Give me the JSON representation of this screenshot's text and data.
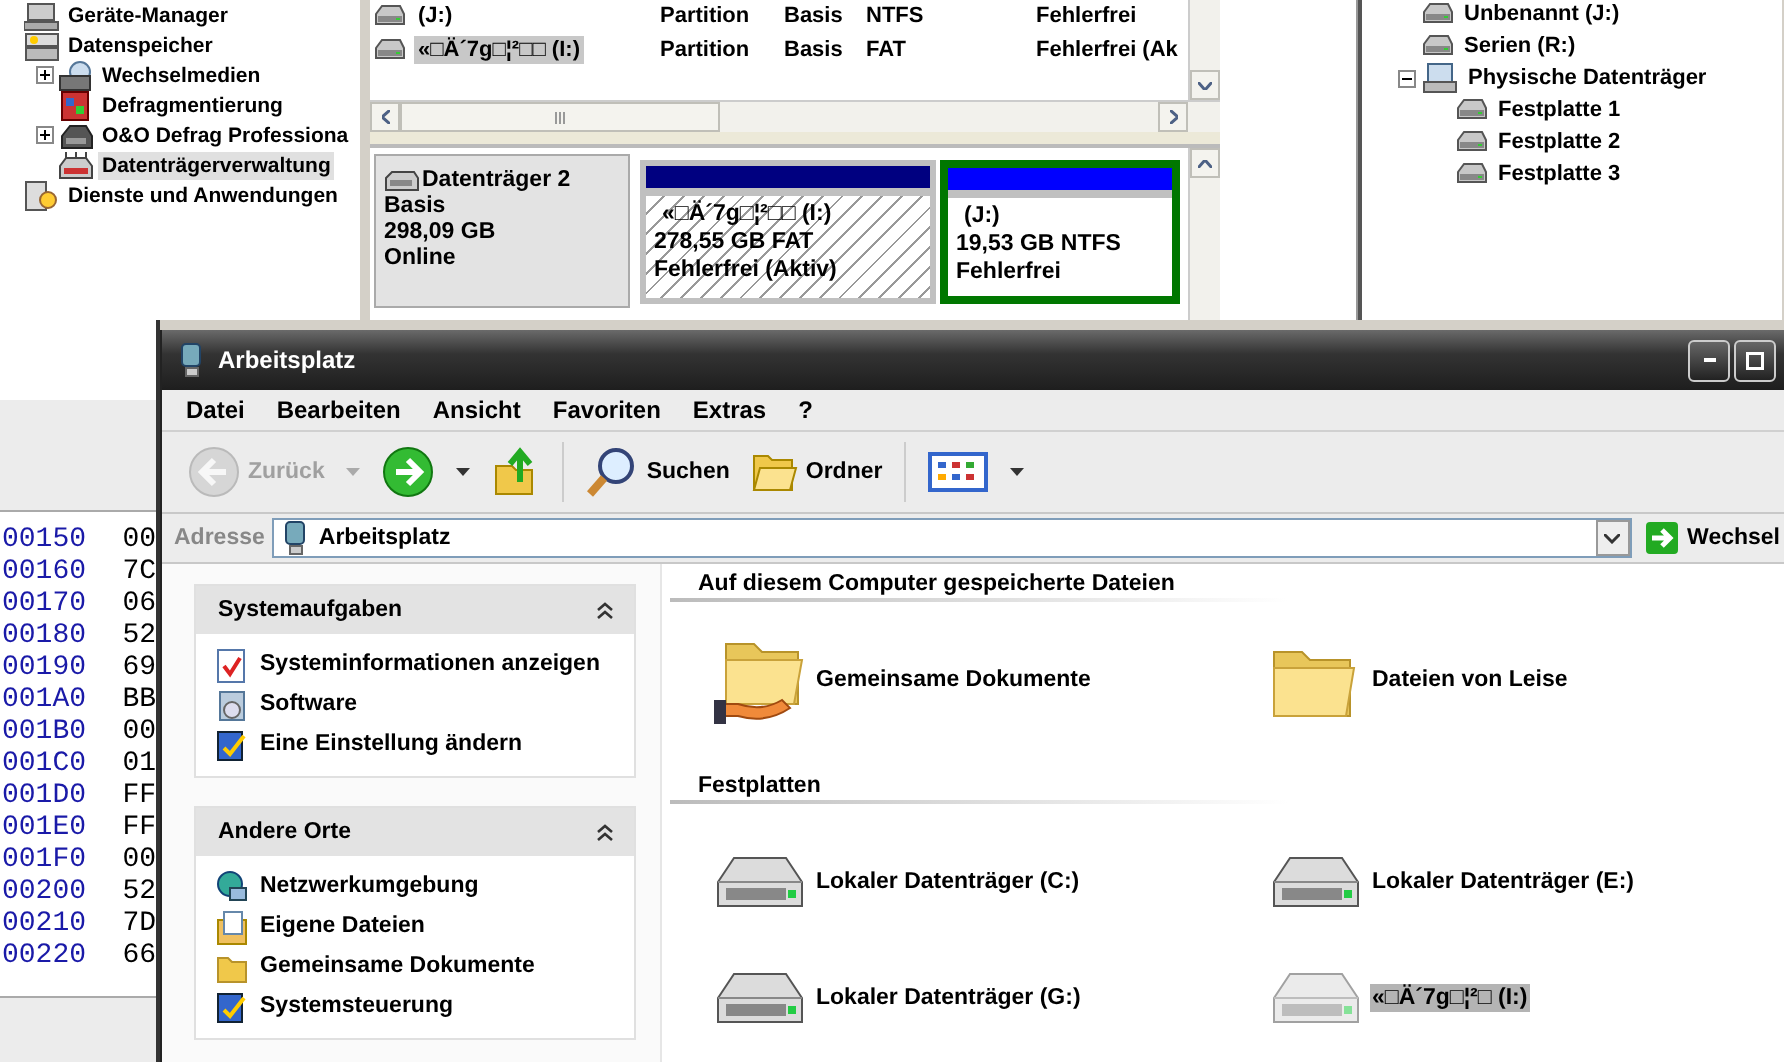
{
  "management_tree": {
    "items": [
      {
        "label": "Geräte-Manager",
        "kind": "devices",
        "selected": false
      },
      {
        "label": "Datenspeicher",
        "kind": "storage",
        "selected": false,
        "children": [
          {
            "label": "Wechselmedien",
            "kind": "removable",
            "expanded": false,
            "selected": false
          },
          {
            "label": "Defragmentierung",
            "kind": "defrag",
            "selected": false
          },
          {
            "label": "O&O Defrag Professiona",
            "kind": "defrag-pro",
            "expanded": false,
            "selected": false
          },
          {
            "label": "Datenträgerverwaltung",
            "kind": "disk-management",
            "selected": true
          }
        ]
      },
      {
        "label": "Dienste und Anwendungen",
        "kind": "services",
        "selected": false
      }
    ]
  },
  "volume_list": {
    "rows": [
      {
        "cells": [
          "(J:)",
          "Partition",
          "Basis",
          "NTFS",
          "Fehlerfrei"
        ],
        "selected": false
      },
      {
        "cells": [
          "«□Ä´7g□¦²□□ (I:)",
          "Partition",
          "Basis",
          "FAT",
          "Fehlerfrei (Ak"
        ],
        "selected": true
      }
    ]
  },
  "disk_map": {
    "disk": {
      "name": "Datenträger 2",
      "type": "Basis",
      "size": "298,09 GB",
      "state": "Online"
    },
    "partitions": [
      {
        "name": "«□Ä´7g□¦²□□  (I:)",
        "size": "278,55 GB FAT",
        "status": "Fehlerfrei (Aktiv)",
        "color": "#000080",
        "hatched": true,
        "selected": false
      },
      {
        "name": "(J:)",
        "size": "19,53 GB NTFS",
        "status": "Fehlerfrei",
        "color": "#0000ff",
        "hatched": false,
        "selected": true
      }
    ]
  },
  "device_tree": {
    "items": [
      {
        "label": "Unbenannt (J:)",
        "kind": "volume",
        "selected": false
      },
      {
        "label": "Serien (R:)",
        "kind": "volume",
        "selected": false
      },
      {
        "label": "Physische Datenträger",
        "kind": "physical",
        "expanded": true,
        "selected": false,
        "children": [
          {
            "label": "Festplatte 1",
            "kind": "volume",
            "selected": false
          },
          {
            "label": "Festplatte 2",
            "kind": "volume",
            "selected": false
          },
          {
            "label": "Festplatte 3",
            "kind": "volume",
            "selected": false
          }
        ]
      }
    ]
  },
  "hex_view": {
    "rows": [
      {
        "cells": [
          "00150",
          "00"
        ]
      },
      {
        "cells": [
          "00160",
          "7C"
        ]
      },
      {
        "cells": [
          "00170",
          "06"
        ]
      },
      {
        "cells": [
          "00180",
          "52"
        ]
      },
      {
        "cells": [
          "00190",
          "69"
        ]
      },
      {
        "cells": [
          "001A0",
          "BB"
        ]
      },
      {
        "cells": [
          "001B0",
          "00"
        ]
      },
      {
        "cells": [
          "001C0",
          "01"
        ]
      },
      {
        "cells": [
          "001D0",
          "FF"
        ]
      },
      {
        "cells": [
          "001E0",
          "FF"
        ]
      },
      {
        "cells": [
          "001F0",
          "00"
        ]
      },
      {
        "cells": [
          "00200",
          "52"
        ]
      },
      {
        "cells": [
          "00210",
          "7D"
        ]
      },
      {
        "cells": [
          "00220",
          "66"
        ]
      }
    ]
  },
  "explorer": {
    "window": {
      "title": "Arbeitsplatz"
    },
    "menu": [
      "Datei",
      "Bearbeiten",
      "Ansicht",
      "Favoriten",
      "Extras",
      "?"
    ],
    "toolbar": [
      {
        "kind": "back",
        "label": "Zurück",
        "disabled": true
      },
      {
        "kind": "forward",
        "disabled": false
      },
      {
        "kind": "up",
        "disabled": false
      },
      {
        "kind": "search",
        "label": "Suchen",
        "disabled": false
      },
      {
        "kind": "folders",
        "label": "Ordner",
        "disabled": false
      },
      {
        "kind": "views",
        "disabled": false
      }
    ],
    "address_bar": {
      "label": "Adresse",
      "value": "Arbeitsplatz",
      "go": "Wechsel"
    },
    "task_panels": [
      {
        "title": "Systemaufgaben",
        "expanded": true,
        "items": [
          {
            "kind": "system-info",
            "label": "Systeminformationen anzeigen"
          },
          {
            "kind": "software",
            "label": "Software"
          },
          {
            "kind": "settings",
            "label": "Eine Einstellung ändern"
          }
        ]
      },
      {
        "title": "Andere Orte",
        "expanded": true,
        "items": [
          {
            "kind": "network",
            "label": "Netzwerkumgebung"
          },
          {
            "kind": "documents",
            "label": "Eigene Dateien"
          },
          {
            "kind": "shared-folder",
            "label": "Gemeinsame Dokumente"
          },
          {
            "kind": "control-panel",
            "label": "Systemsteuerung"
          }
        ]
      }
    ],
    "groups": [
      {
        "title": "Auf diesem Computer gespeicherte Dateien",
        "items": [
          {
            "kind": "shared-folder",
            "label": "Gemeinsame Dokumente",
            "selected": false
          },
          {
            "kind": "folder",
            "label": "Dateien von Leise",
            "selected": false
          }
        ]
      },
      {
        "title": "Festplatten",
        "items": [
          {
            "kind": "drive",
            "label": "Lokaler Datenträger (C:)",
            "selected": false
          },
          {
            "kind": "drive",
            "label": "Lokaler Datenträger (E:)",
            "selected": false
          },
          {
            "kind": "drive",
            "label": "Lokaler Datenträger (G:)",
            "selected": false
          },
          {
            "kind": "drive",
            "label": "«□Ä´7g□¦²□ (I:)",
            "selected": true
          }
        ]
      }
    ]
  }
}
